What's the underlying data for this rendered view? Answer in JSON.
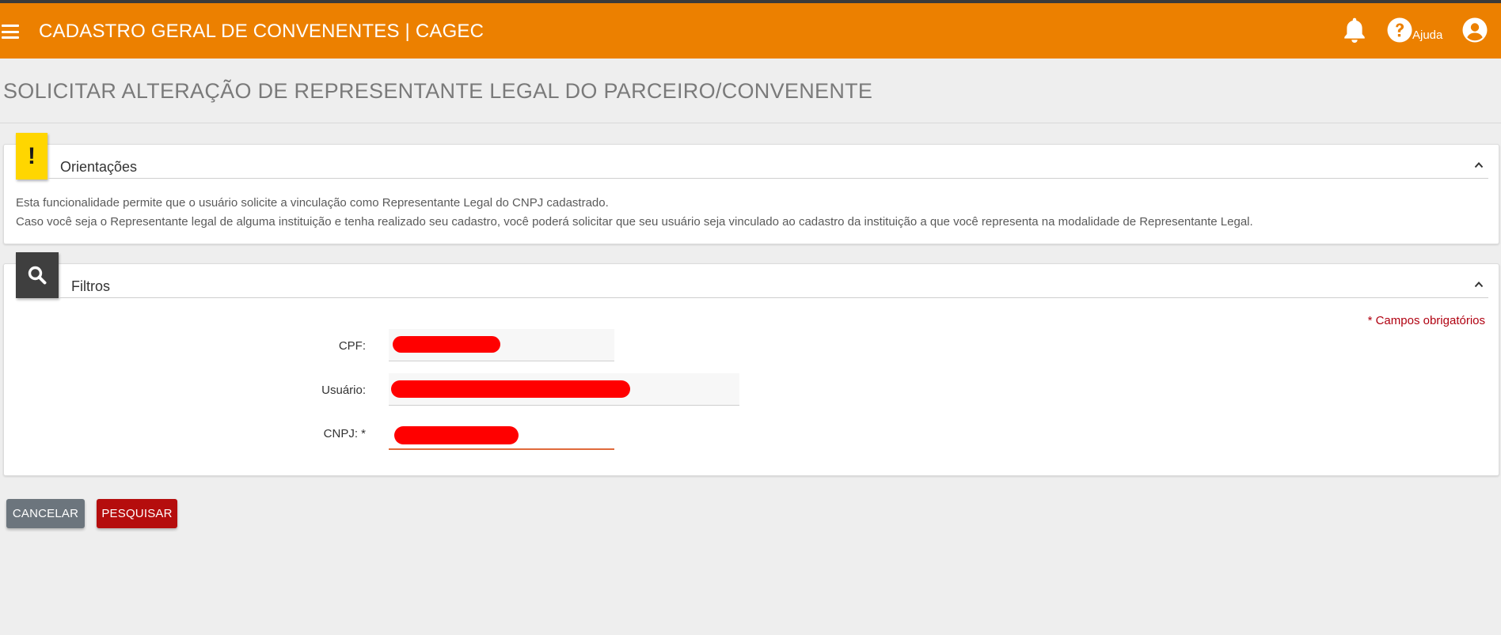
{
  "header": {
    "title": "CADASTRO GERAL DE CONVENENTES | CAGEC",
    "menu_icon": "hamburger-menu-icon",
    "notifications_icon": "bell-icon",
    "help_icon": "question-circle-icon",
    "help_label": "Ajuda",
    "user_icon": "user-circle-icon",
    "bg_color": "#ec8000"
  },
  "page": {
    "title": "SOLICITAR ALTERAÇÃO DE REPRESENTANTE LEGAL DO PARCEIRO/CONVENENTE"
  },
  "orientacoes": {
    "badge_icon": "exclamation-icon",
    "badge_text": "!",
    "heading": "Orientações",
    "collapse_icon": "chevron-up-icon",
    "line1": "Esta funcionalidade permite que o usuário solicite a vinculação como Representante Legal do CNPJ cadastrado.",
    "line2": "Caso você seja o Representante legal de alguma instituição e tenha realizado seu cadastro, você poderá solicitar que seu usuário seja vinculado ao cadastro da instituição a que você representa na modalidade de Representante Legal."
  },
  "filtros": {
    "badge_icon": "search-icon",
    "heading": "Filtros",
    "collapse_icon": "chevron-up-icon",
    "required_note": "* Campos obrigatórios",
    "fields": {
      "cpf": {
        "label": "CPF:"
      },
      "usuario": {
        "label": "Usuário:"
      },
      "cnpj": {
        "label": "CNPJ: *"
      }
    }
  },
  "actions": {
    "cancel_label": "CANCELAR",
    "search_label": "PESQUISAR"
  }
}
